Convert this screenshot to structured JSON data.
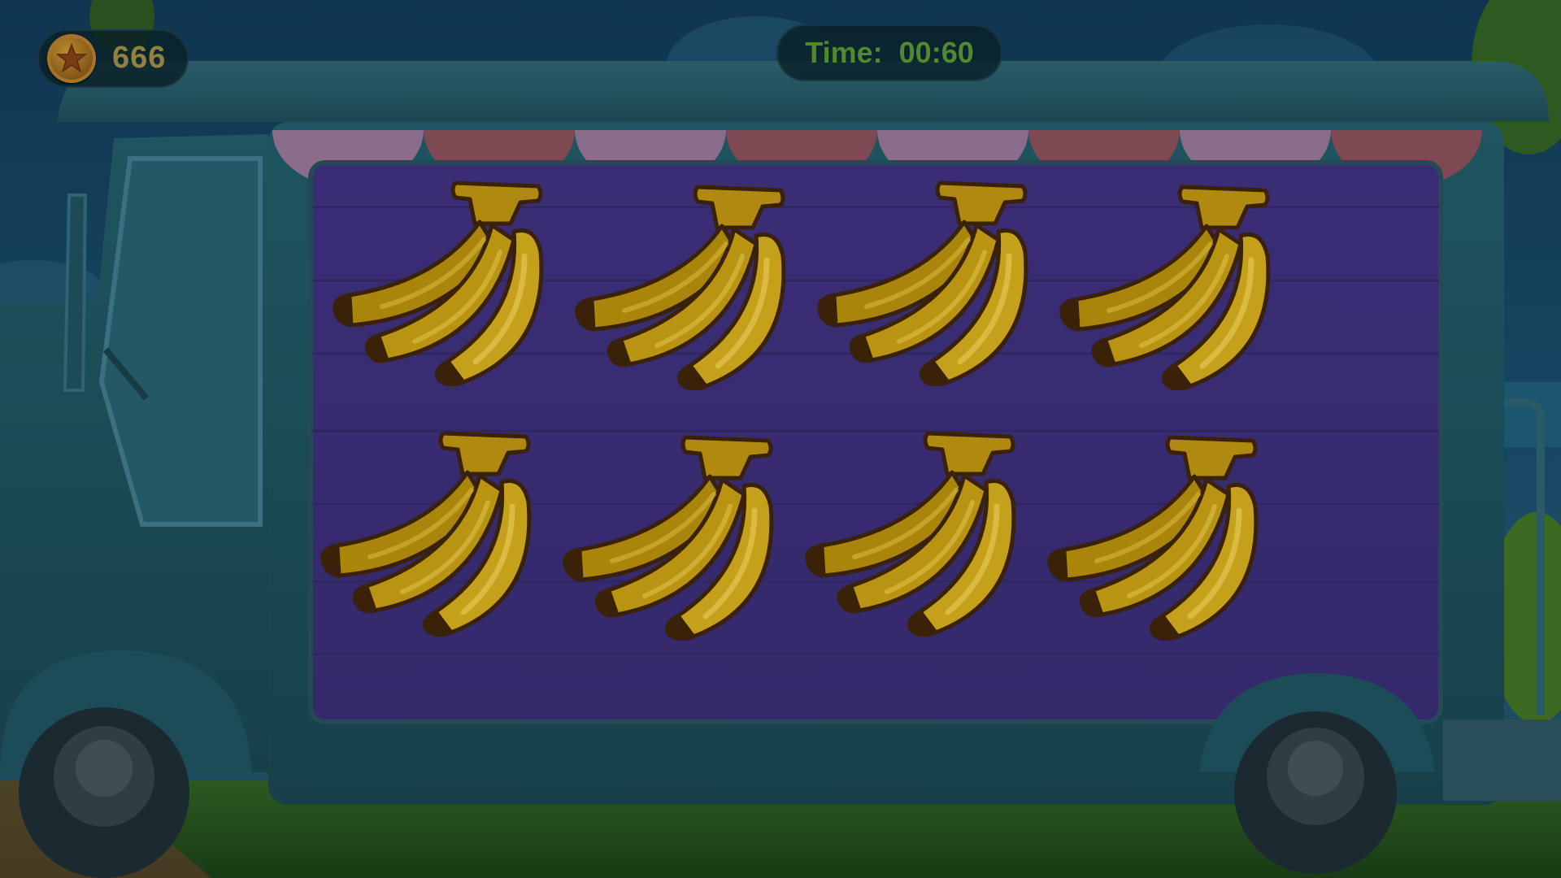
{
  "hud": {
    "coins": "666",
    "coin_icon": "star-coin-icon",
    "timer_label": "Time:",
    "timer_value": "00:60"
  },
  "board": {
    "rows": 2,
    "cols": 4,
    "cards": [
      {
        "item": "banana-bunch"
      },
      {
        "item": "banana-bunch"
      },
      {
        "item": "banana-bunch"
      },
      {
        "item": "banana-bunch"
      },
      {
        "item": "banana-bunch"
      },
      {
        "item": "banana-bunch"
      },
      {
        "item": "banana-bunch"
      },
      {
        "item": "banana-bunch"
      }
    ]
  },
  "colors": {
    "timer_text": "#4f8b2a",
    "coin_text": "#8f8240",
    "board_purple": "#3e2f7c",
    "awning_pink": "#8a6d8b",
    "awning_red": "#7f4954"
  }
}
